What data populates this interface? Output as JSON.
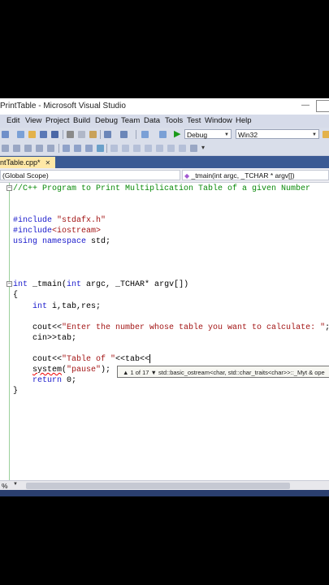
{
  "window": {
    "title": "PrintTable - Microsoft Visual Studio"
  },
  "menu": [
    "Edit",
    "View",
    "Project",
    "Build",
    "Debug",
    "Team",
    "Data",
    "Tools",
    "Test",
    "Window",
    "Help"
  ],
  "toolbar": {
    "config": "Debug",
    "platform": "Win32"
  },
  "tab": {
    "label": "ntTable.cpp*",
    "close": "✕"
  },
  "nav": {
    "scope": "(Global Scope)",
    "member": "_tmain(int argc, _TCHAR * argv[])"
  },
  "code": {
    "l1": "//C++ Program to Print Multiplication Table of a given Number",
    "l2_kw": "#include",
    "l2_str": " \"stdafx.h\"",
    "l3_kw": "#include",
    "l3_str": "<iostream>",
    "l4_kw1": "using",
    "l4_sp": " ",
    "l4_kw2": "namespace",
    "l4_rest": " std;",
    "l5_kw1": "int",
    "l5_mid": " _tmain(",
    "l5_kw2": "int",
    "l5_rest": " argc, _TCHAR* argv[])",
    "l6": "{",
    "l7_kw": "int",
    "l7_rest": " i,tab,res;",
    "l8_a": "cout<<",
    "l8_str": "\"Enter the number whose table you want to calculate: \"",
    "l8_b": ";",
    "l9": "cin>>tab;",
    "l10_a": "cout<<",
    "l10_str": "\"Table of \"",
    "l10_b": "<<tab<<",
    "l11_sq": "system",
    "l11_a": "(",
    "l11_str": "\"pause\"",
    "l11_b": ");",
    "l12_kw": "return",
    "l12_rest": " 0;",
    "l13": "}"
  },
  "tooltip": {
    "text": "▲ 1 of 17 ▼   std::basic_ostream<char, std::char_traits<char>>::_Myt & ope"
  },
  "status": {
    "zoom": "%"
  },
  "colors": {
    "tab_active": "#ffe8a6",
    "tabbar": "#3b5a94",
    "keyword": "#1a1acc",
    "comment": "#0a8a0a",
    "string": "#a31515"
  }
}
